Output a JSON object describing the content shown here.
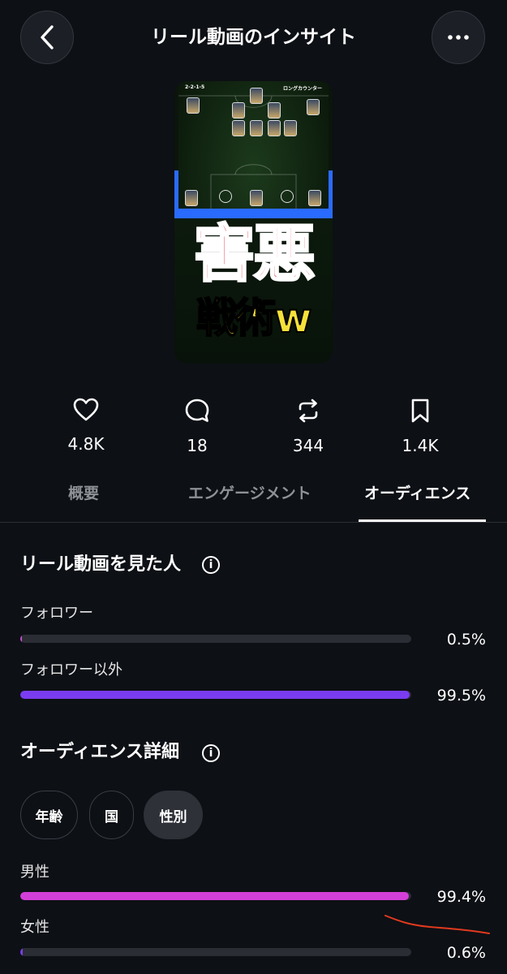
{
  "header": {
    "title": "リール動画のインサイト"
  },
  "thumbnail": {
    "formation": "2-2-1-5",
    "tactic": "ロングカウンター",
    "caption_line1": "害悪",
    "caption_line2": "戦術w"
  },
  "stats": [
    {
      "icon": "heart-icon",
      "value": "4.8K"
    },
    {
      "icon": "comment-icon",
      "value": "18"
    },
    {
      "icon": "repost-icon",
      "value": "344"
    },
    {
      "icon": "bookmark-icon",
      "value": "1.4K"
    }
  ],
  "tabs": [
    {
      "label": "概要",
      "active": false
    },
    {
      "label": "エンゲージメント",
      "active": false
    },
    {
      "label": "オーディエンス",
      "active": true
    }
  ],
  "viewers": {
    "title": "リール動画を見た人",
    "rows": [
      {
        "label": "フォロワー",
        "percent": "0.5%",
        "fraction": 0.005,
        "color": "#c94fd6"
      },
      {
        "label": "フォロワー以外",
        "percent": "99.5%",
        "fraction": 0.995,
        "color": "#7a3cf0"
      }
    ]
  },
  "audience_details": {
    "title": "オーディエンス詳細",
    "filters": [
      {
        "label": "年齢",
        "active": false
      },
      {
        "label": "国",
        "active": false
      },
      {
        "label": "性別",
        "active": true
      }
    ],
    "rows": [
      {
        "label": "男性",
        "percent": "99.4%",
        "fraction": 0.994,
        "color": "#d23fd8"
      },
      {
        "label": "女性",
        "percent": "0.6%",
        "fraction": 0.006,
        "color": "#7a3cf0"
      }
    ]
  },
  "annotation_color": "#e03a1e"
}
